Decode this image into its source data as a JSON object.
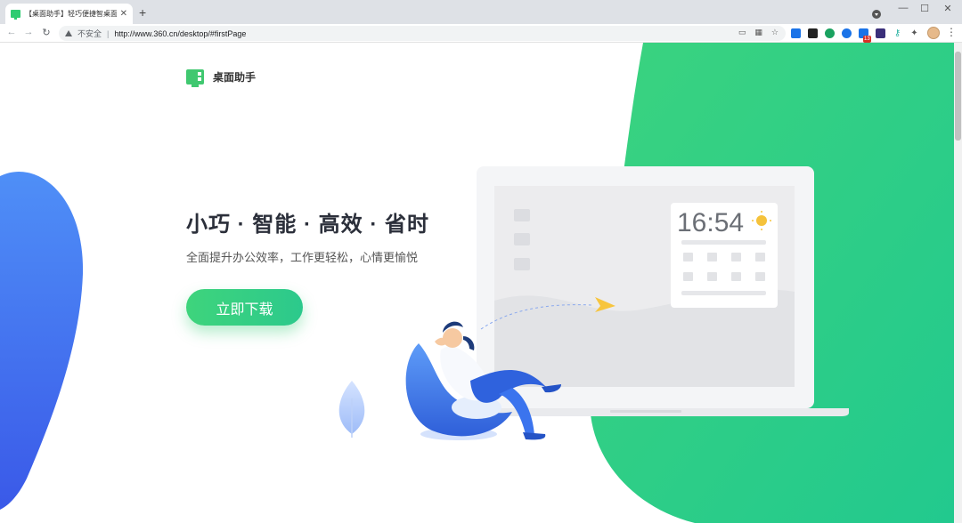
{
  "browser": {
    "tab_title": "【桌面助手】轻巧便捷智桌面, 省",
    "tab_close": "✕",
    "new_tab": "+",
    "window_controls": {
      "minimize": "—",
      "maximize": "☐",
      "close": "✕"
    },
    "nav": {
      "back": "←",
      "forward": "→",
      "reload": "↻"
    },
    "security_label": "不安全",
    "url": "http://www.360.cn/desktop/#firstPage",
    "extension_badge": "13",
    "extension_colors": [
      "#1a73e8",
      "#222222",
      "#1aa260",
      "#1a73e8",
      "#1a73e8",
      "#3a2f7a",
      "#2bb3a3",
      "#555555"
    ]
  },
  "page": {
    "brand_name": "桌面助手",
    "headline": "小巧 · 智能 · 高效 · 省时",
    "subline": "全面提升办公效率，工作更轻松，心情更愉悦",
    "download_label": "立即下载",
    "illustration": {
      "clock_time": "16:54",
      "accent_color": "#2ecc71",
      "blue_color": "#3d7bf0"
    }
  }
}
